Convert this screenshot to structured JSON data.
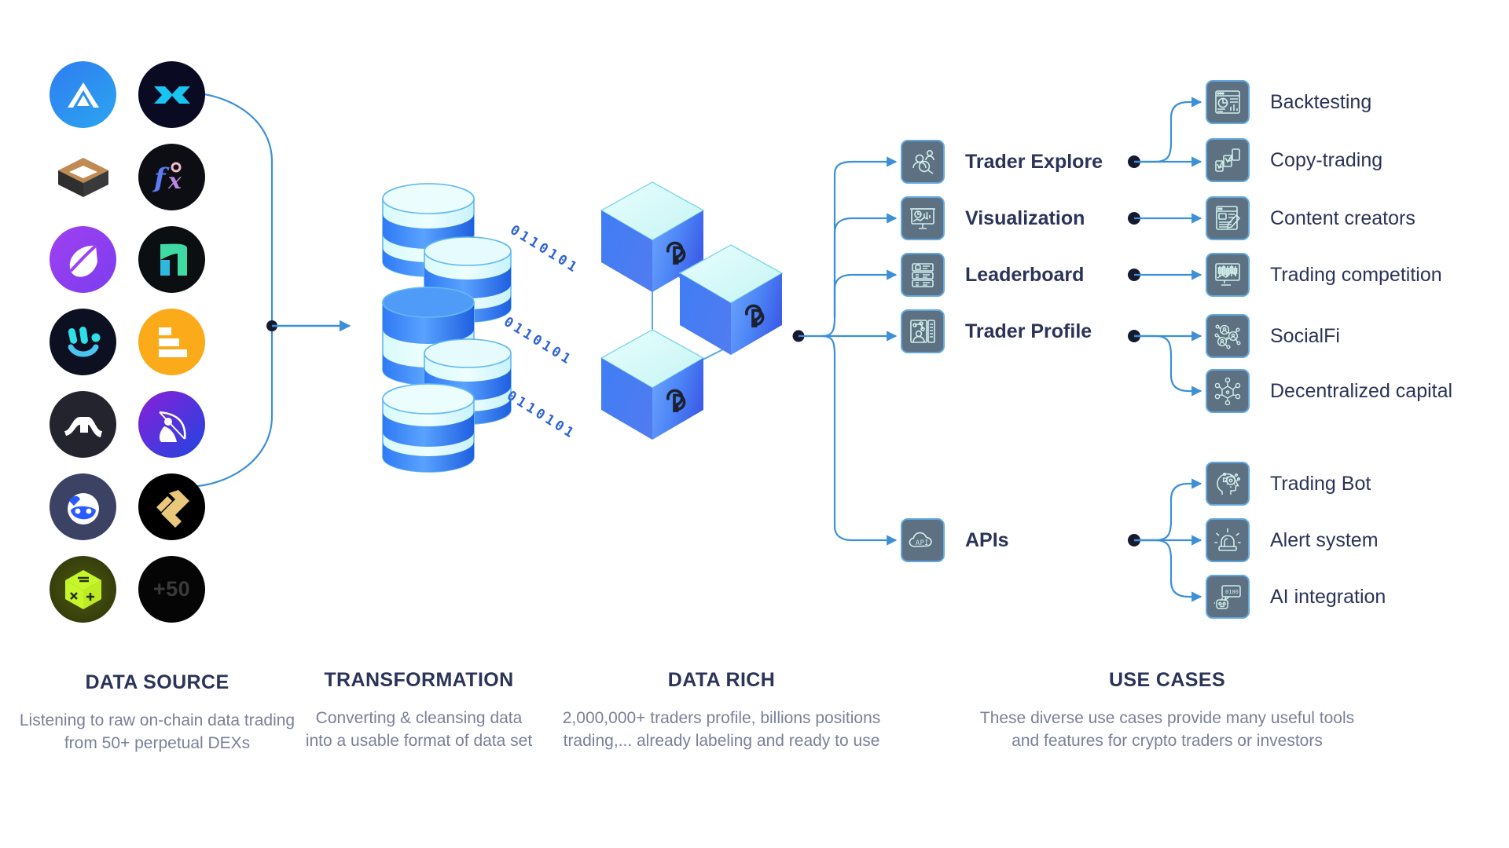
{
  "stages": [
    {
      "key": "data_source",
      "title": "DATA SOURCE",
      "description": "Listening to raw on-chain data trading from 50+ perpetual DEXs"
    },
    {
      "key": "transformation",
      "title": "TRANSFORMATION",
      "description": "Converting & cleansing data into a usable format of data set"
    },
    {
      "key": "data_rich",
      "title": "DATA RICH",
      "description": "2,000,000+ traders profile, billions positions trading,... already labeling and ready to use"
    },
    {
      "key": "use_cases",
      "title": "USE CASES",
      "description": "These diverse use cases provide many useful tools and features for crypto traders or investors"
    }
  ],
  "data_sources": [
    {
      "name": "dex-logo-1",
      "icon": "triangle-a-mark",
      "label": ""
    },
    {
      "name": "dex-logo-2",
      "icon": "crossed-arrows-mark",
      "label": ""
    },
    {
      "name": "dex-logo-3",
      "icon": "open-box-mark",
      "label": ""
    },
    {
      "name": "dex-logo-4",
      "icon": "fx-script-mark",
      "label": ""
    },
    {
      "name": "dex-logo-5",
      "icon": "planet-orbit-mark",
      "label": ""
    },
    {
      "name": "dex-logo-6",
      "icon": "green-arrow-mark",
      "label": ""
    },
    {
      "name": "dex-logo-7",
      "icon": "smiley-face-mark",
      "label": ""
    },
    {
      "name": "dex-logo-8",
      "icon": "orange-bars-mark",
      "label": ""
    },
    {
      "name": "dex-logo-9",
      "icon": "zigzag-wave-mark",
      "label": ""
    },
    {
      "name": "dex-logo-10",
      "icon": "archer-bow-mark",
      "label": ""
    },
    {
      "name": "dex-logo-11",
      "icon": "blue-blob-face-mark",
      "label": ""
    },
    {
      "name": "dex-logo-12",
      "icon": "gold-s-mark",
      "label": ""
    },
    {
      "name": "dex-logo-13",
      "icon": "green-cube-mark",
      "label": ""
    },
    {
      "name": "dex-logo-14",
      "icon": "more-count",
      "label": "+50"
    }
  ],
  "transformation": {
    "binary_strings": [
      "0110101",
      "0110101",
      "0110101"
    ],
    "cylinder_count": 5
  },
  "data_rich": {
    "cube_logo": "cp-logo",
    "cube_count": 3
  },
  "products": [
    {
      "label": "Trader Explore",
      "icon": "trader-search-icon"
    },
    {
      "label": "Visualization",
      "icon": "chart-board-icon"
    },
    {
      "label": "Leaderboard",
      "icon": "ranking-list-icon"
    },
    {
      "label": "Trader Profile",
      "icon": "profile-card-icon"
    },
    {
      "label": "APIs",
      "icon": "api-cloud-icon"
    }
  ],
  "use_cases_group_a": [
    {
      "label": "Backtesting",
      "icon": "dashboard-report-icon"
    },
    {
      "label": "Copy-trading",
      "icon": "growth-boxes-icon"
    },
    {
      "label": "Content creators",
      "icon": "article-pencil-icon"
    },
    {
      "label": "Trading competition",
      "icon": "candlestick-monitor-icon"
    },
    {
      "label": "SocialFi",
      "icon": "social-network-icon"
    },
    {
      "label": "Decentralized capital",
      "icon": "decentralized-node-icon"
    }
  ],
  "use_cases_group_b": [
    {
      "label": "Trading Bot",
      "icon": "ai-head-gear-icon"
    },
    {
      "label": "Alert system",
      "icon": "siren-alert-icon"
    },
    {
      "label": "AI integration",
      "icon": "robot-chat-icon"
    }
  ],
  "colors": {
    "accent_blue": "#3d8fd6",
    "tile_bg": "#5d7183",
    "tile_border": "#62a8e0",
    "tile_icon": "#cfeee7",
    "title_navy": "#2b3358",
    "body_gray": "#7a8099",
    "binary_blue": "#2f63d6",
    "node_dot": "#161a2e",
    "background": "#ffffff"
  }
}
